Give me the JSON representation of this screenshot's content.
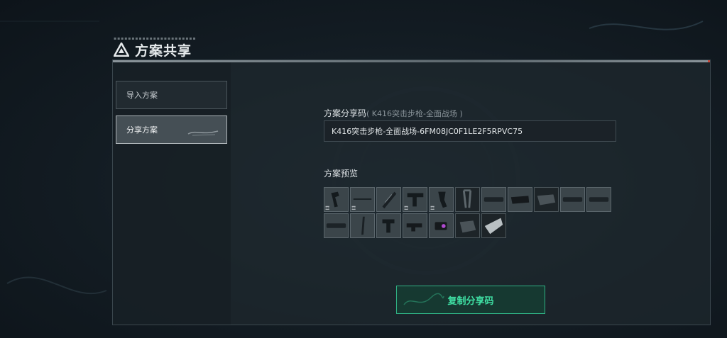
{
  "header": {
    "title": "方案共享",
    "icon": "tactical-triangle-icon"
  },
  "sidebar": {
    "items": [
      {
        "label": "导入方案",
        "active": false
      },
      {
        "label": "分享方案",
        "active": true
      }
    ]
  },
  "share": {
    "label": "方案分享码",
    "sublabel": "( K416突击步枪-全面战场 )",
    "code_value": "K416突击步枪-全面战场-6FM08JC0F1LE2F5RPVC75"
  },
  "preview": {
    "label": "方案预览",
    "slots": [
      {
        "icon": "grip-part-icon",
        "tag": "☲",
        "dark": false
      },
      {
        "icon": "barrel-part-icon",
        "tag": "☲",
        "dark": false
      },
      {
        "icon": "rail-part-icon",
        "tag": "",
        "dark": false
      },
      {
        "icon": "foregrip-part-icon",
        "tag": "☲",
        "dark": false
      },
      {
        "icon": "magazine-part-icon",
        "tag": "☲",
        "dark": false
      },
      {
        "icon": "bipod-part-icon",
        "tag": "",
        "dark": true
      },
      {
        "icon": "muzzle-part-icon",
        "tag": "",
        "dark": false
      },
      {
        "icon": "stock-part-icon",
        "tag": "",
        "dark": false
      },
      {
        "icon": "stock-pad-part-icon",
        "tag": "",
        "dark": true
      },
      {
        "icon": "handguard-part-icon",
        "tag": "",
        "dark": false
      },
      {
        "icon": "suppressor-part-icon",
        "tag": "",
        "dark": false
      },
      {
        "icon": "suppressor-long-part-icon",
        "tag": "",
        "dark": false
      },
      {
        "icon": "vertical-grip-part-icon",
        "tag": "",
        "dark": false
      },
      {
        "icon": "pistol-grip-part-icon",
        "tag": "",
        "dark": false
      },
      {
        "icon": "optic-part-icon",
        "tag": "",
        "dark": false
      },
      {
        "icon": "red-dot-sight-part-icon",
        "tag": "",
        "dark": false
      },
      {
        "icon": "receiver-part-icon",
        "tag": "",
        "dark": true
      },
      {
        "icon": "buttstock-part-icon",
        "tag": "",
        "dark": true
      }
    ]
  },
  "actions": {
    "copy_label": "复制分享码"
  },
  "colors": {
    "accent": "#3fe0a4",
    "accent_border": "#2fb083",
    "panel_bg": "#1e282e"
  }
}
